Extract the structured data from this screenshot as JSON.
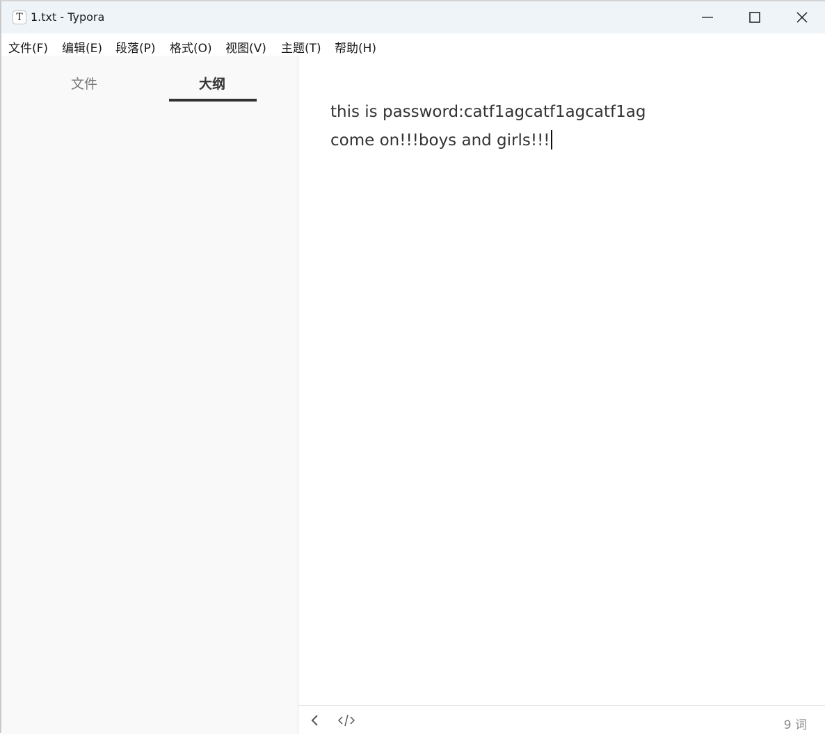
{
  "window": {
    "title": "1.txt - Typora",
    "app_icon_letter": "T",
    "controls": [
      "minimize-icon",
      "maximize-icon",
      "close-icon"
    ]
  },
  "menu": {
    "items": [
      {
        "label": "文件(F)"
      },
      {
        "label": "编辑(E)"
      },
      {
        "label": "段落(P)"
      },
      {
        "label": "格式(O)"
      },
      {
        "label": "视图(V)"
      },
      {
        "label": "主题(T)"
      },
      {
        "label": "帮助(H)"
      }
    ]
  },
  "sidebar": {
    "tabs": [
      {
        "label": "文件",
        "active": false
      },
      {
        "label": "大纲",
        "active": true
      }
    ]
  },
  "editor": {
    "lines": [
      "this is password:catf1agcatf1agcatf1ag",
      "come on!!!boys and girls!!!"
    ]
  },
  "statusbar": {
    "back_icon": "chevron-left-icon",
    "source_icon": "code-icon",
    "word_count": "9 词"
  },
  "colors": {
    "titlebar_bg": "#eff4f9",
    "sidebar_bg": "#f9f9f9",
    "text": "#333333"
  }
}
